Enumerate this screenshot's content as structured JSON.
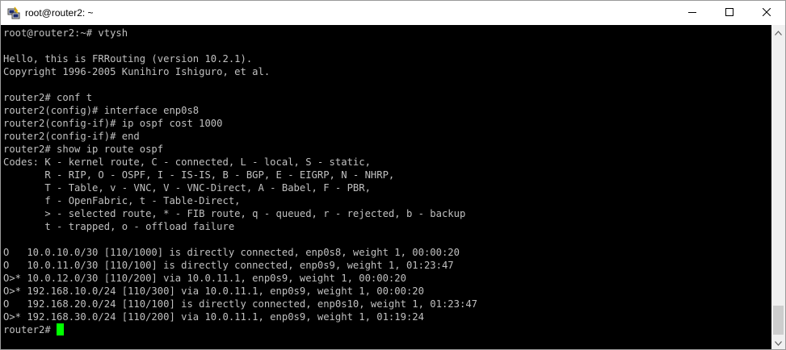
{
  "window": {
    "title": "root@router2: ~",
    "app_icon": "putty-icon",
    "controls": {
      "minimize": "minimize-icon",
      "maximize": "maximize-icon",
      "close": "close-icon"
    }
  },
  "terminal": {
    "lines": [
      "root@router2:~# vtysh",
      "",
      "Hello, this is FRRouting (version 10.2.1).",
      "Copyright 1996-2005 Kunihiro Ishiguro, et al.",
      "",
      "router2# conf t",
      "router2(config)# interface enp0s8",
      "router2(config-if)# ip ospf cost 1000",
      "router2(config-if)# end",
      "router2# show ip route ospf",
      "Codes: K - kernel route, C - connected, L - local, S - static,",
      "       R - RIP, O - OSPF, I - IS-IS, B - BGP, E - EIGRP, N - NHRP,",
      "       T - Table, v - VNC, V - VNC-Direct, A - Babel, F - PBR,",
      "       f - OpenFabric, t - Table-Direct,",
      "       > - selected route, * - FIB route, q - queued, r - rejected, b - backup",
      "       t - trapped, o - offload failure",
      "",
      "O   10.0.10.0/30 [110/1000] is directly connected, enp0s8, weight 1, 00:00:20",
      "O   10.0.11.0/30 [110/100] is directly connected, enp0s9, weight 1, 01:23:47",
      "O>* 10.0.12.0/30 [110/200] via 10.0.11.1, enp0s9, weight 1, 00:00:20",
      "O>* 192.168.10.0/24 [110/300] via 10.0.11.1, enp0s9, weight 1, 00:00:20",
      "O   192.168.20.0/24 [110/100] is directly connected, enp0s10, weight 1, 01:23:47",
      "O>* 192.168.30.0/24 [110/200] via 10.0.11.1, enp0s9, weight 1, 01:19:24"
    ],
    "prompt": "router2#",
    "cursor_color": "#00ff00",
    "foreground_color": "#c0c0c0",
    "background_color": "#000000"
  }
}
